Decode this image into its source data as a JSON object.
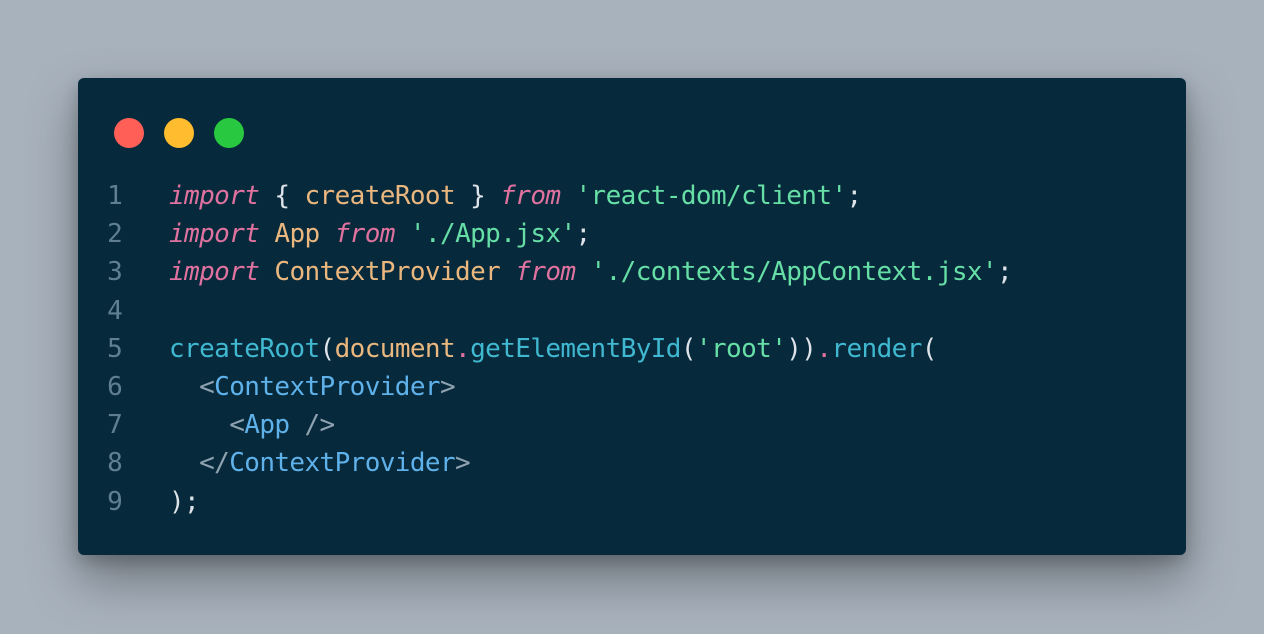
{
  "window": {
    "buttons": {
      "close_color": "#ff5f57",
      "minimize_color": "#febc2e",
      "maximize_color": "#28c840"
    }
  },
  "code": {
    "line_numbers": [
      "1",
      "2",
      "3",
      "4",
      "5",
      "6",
      "7",
      "8",
      "9"
    ],
    "lines": [
      [
        {
          "t": "import",
          "c": "kw"
        },
        {
          "t": " { ",
          "c": "punc"
        },
        {
          "t": "createRoot",
          "c": "id"
        },
        {
          "t": " } ",
          "c": "punc"
        },
        {
          "t": "from",
          "c": "kw"
        },
        {
          "t": " ",
          "c": "punc"
        },
        {
          "t": "'react-dom/client'",
          "c": "str"
        },
        {
          "t": ";",
          "c": "punc"
        }
      ],
      [
        {
          "t": "import",
          "c": "kw"
        },
        {
          "t": " ",
          "c": "punc"
        },
        {
          "t": "App",
          "c": "id"
        },
        {
          "t": " ",
          "c": "punc"
        },
        {
          "t": "from",
          "c": "kw"
        },
        {
          "t": " ",
          "c": "punc"
        },
        {
          "t": "'./App.jsx'",
          "c": "str"
        },
        {
          "t": ";",
          "c": "punc"
        }
      ],
      [
        {
          "t": "import",
          "c": "kw"
        },
        {
          "t": " ",
          "c": "punc"
        },
        {
          "t": "ContextProvider",
          "c": "id"
        },
        {
          "t": " ",
          "c": "punc"
        },
        {
          "t": "from",
          "c": "kw"
        },
        {
          "t": " ",
          "c": "punc"
        },
        {
          "t": "'./contexts/AppContext.jsx'",
          "c": "str"
        },
        {
          "t": ";",
          "c": "punc"
        }
      ],
      [],
      [
        {
          "t": "createRoot",
          "c": "fn"
        },
        {
          "t": "(",
          "c": "punc"
        },
        {
          "t": "document",
          "c": "id"
        },
        {
          "t": ".",
          "c": "dotop"
        },
        {
          "t": "getElementById",
          "c": "fn"
        },
        {
          "t": "(",
          "c": "punc"
        },
        {
          "t": "'root'",
          "c": "str"
        },
        {
          "t": "))",
          "c": "punc"
        },
        {
          "t": ".",
          "c": "dotop"
        },
        {
          "t": "render",
          "c": "fn"
        },
        {
          "t": "(",
          "c": "punc"
        }
      ],
      [
        {
          "t": "  ",
          "c": "punc"
        },
        {
          "t": "<",
          "c": "br"
        },
        {
          "t": "ContextProvider",
          "c": "tag"
        },
        {
          "t": ">",
          "c": "br"
        }
      ],
      [
        {
          "t": "    ",
          "c": "punc"
        },
        {
          "t": "<",
          "c": "br"
        },
        {
          "t": "App",
          "c": "tag"
        },
        {
          "t": " />",
          "c": "br"
        }
      ],
      [
        {
          "t": "  ",
          "c": "punc"
        },
        {
          "t": "</",
          "c": "br"
        },
        {
          "t": "ContextProvider",
          "c": "tag"
        },
        {
          "t": ">",
          "c": "br"
        }
      ],
      [
        {
          "t": ");",
          "c": "punc"
        }
      ]
    ]
  }
}
